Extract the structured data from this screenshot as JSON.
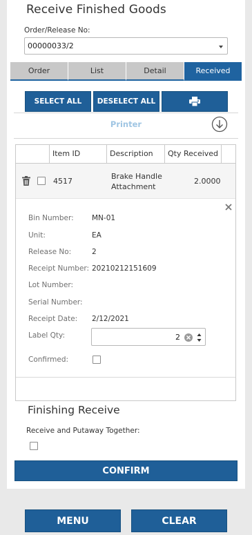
{
  "header": {
    "title": "Receive Finished Goods"
  },
  "order": {
    "label": "Order/Release No:",
    "value": "00000033/2"
  },
  "tabs": [
    "Order",
    "List",
    "Detail",
    "Received"
  ],
  "actions": {
    "select_all": "SELECT ALL",
    "deselect_all": "DESELECT ALL",
    "printer_label": "Printer"
  },
  "grid": {
    "columns": [
      "Item ID",
      "Description",
      "Qty Received"
    ],
    "row": {
      "item_id": "4517",
      "description_line1": "Brake Handle",
      "description_line2": "Attachment",
      "qty": "2.0000"
    }
  },
  "detail": {
    "bin_label": "Bin Number:",
    "bin_value": "MN-01",
    "unit_label": "Unit:",
    "unit_value": "EA",
    "release_label": "Release No:",
    "release_value": "2",
    "receipt_label": "Receipt Number:",
    "receipt_value": "20210212151609",
    "lot_label": "Lot Number:",
    "serial_label": "Serial Number:",
    "date_label": "Receipt Date:",
    "date_value": "2/12/2021",
    "labelqty_label": "Label Qty:",
    "labelqty_value": "2",
    "confirmed_label": "Confirmed:"
  },
  "finishing": {
    "title": "Finishing Receive",
    "together_label": "Receive and Putaway Together:",
    "confirm": "CONFIRM"
  },
  "footer": {
    "menu": "MENU",
    "clear": "CLEAR"
  },
  "colors": {
    "primary": "#1f5f98",
    "tab_inactive": "#c8c8c8",
    "printer_text": "#9fc5e3"
  }
}
